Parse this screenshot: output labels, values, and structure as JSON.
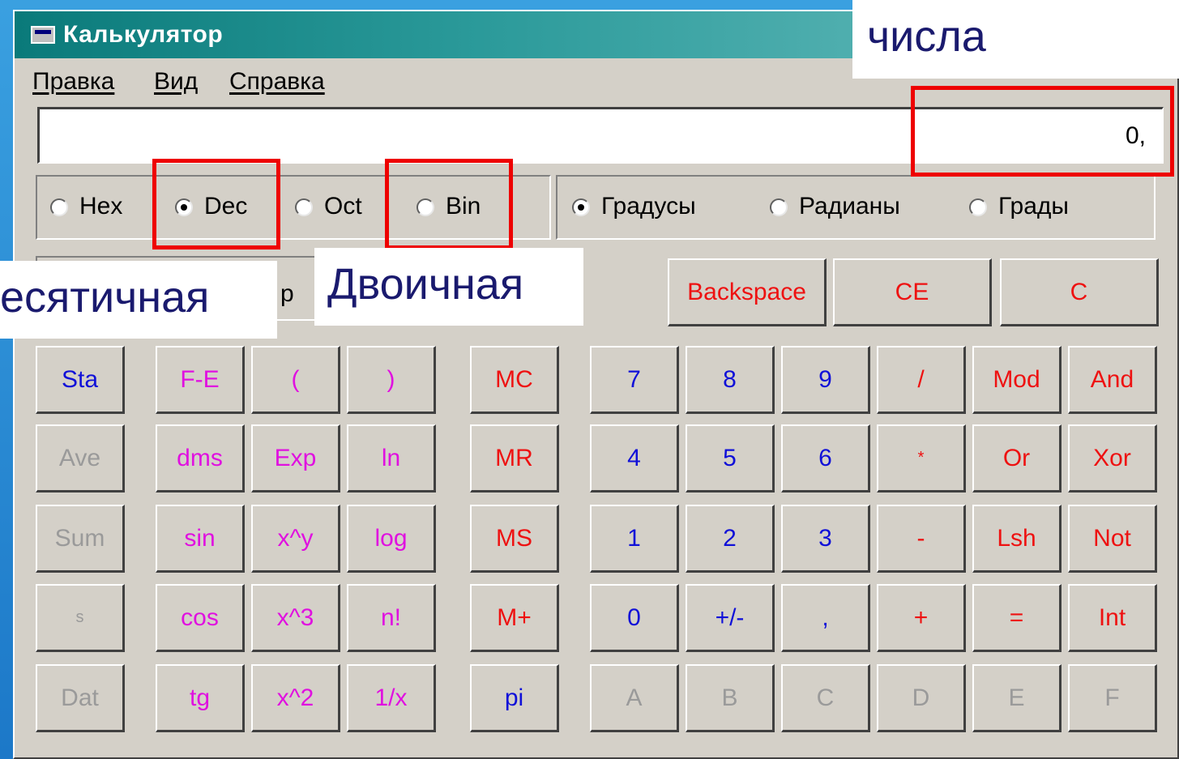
{
  "window": {
    "title": "Калькулятор"
  },
  "menu": [
    "Правка",
    "Вид",
    "Справка"
  ],
  "display": {
    "value": "0,"
  },
  "number_system": [
    {
      "label": "Hex",
      "checked": false
    },
    {
      "label": "Dec",
      "checked": true
    },
    {
      "label": "Oct",
      "checked": false
    },
    {
      "label": "Bin",
      "checked": false
    }
  ],
  "angle_mode": [
    {
      "label": "Градусы",
      "checked": true
    },
    {
      "label": "Радианы",
      "checked": false
    },
    {
      "label": "Грады",
      "checked": false
    }
  ],
  "checkbox_hint": "р",
  "edit_buttons": [
    "Backspace",
    "CE",
    "C"
  ],
  "stat_buttons": [
    "Sta",
    "Ave",
    "Sum",
    "s",
    "Dat"
  ],
  "sci_col1": [
    "F-E",
    "dms",
    "sin",
    "cos",
    "tg"
  ],
  "sci_col2": [
    "(",
    "Exp",
    "x^y",
    "x^3",
    "x^2"
  ],
  "sci_col3": [
    ")",
    "ln",
    "log",
    "n!",
    "1/x"
  ],
  "memory_buttons": [
    "MC",
    "MR",
    "MS",
    "M+",
    "pi"
  ],
  "keypad_rows": [
    [
      "7",
      "8",
      "9",
      "/",
      "Mod",
      "And"
    ],
    [
      "4",
      "5",
      "6",
      "*",
      "Or",
      "Xor"
    ],
    [
      "1",
      "2",
      "3",
      "-",
      "Lsh",
      "Not"
    ],
    [
      "0",
      "+/-",
      ",",
      "+",
      "=",
      "Int"
    ],
    [
      "A",
      "B",
      "C",
      "D",
      "E",
      "F"
    ]
  ],
  "annotations": {
    "top_right": "числа",
    "decimal": "есятичная",
    "binary": "Двоичная"
  },
  "colors": {
    "red": "#ee1111",
    "blue": "#1010d8",
    "magenta": "#e010e0",
    "disabled": "#9a9a9a"
  }
}
